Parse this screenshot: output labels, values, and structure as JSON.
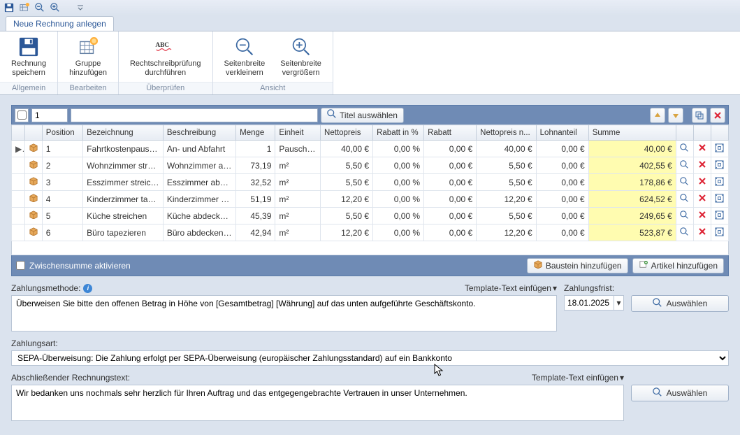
{
  "qat": {
    "icons": [
      "save",
      "new-table",
      "zoom-out",
      "zoom-in",
      "dropdown"
    ]
  },
  "ribbon_tab": "Neue Rechnung anlegen",
  "ribbon": {
    "groups": [
      {
        "title": "Allgemein",
        "buttons": [
          {
            "id": "save",
            "label": "Rechnung\nspeichern"
          }
        ]
      },
      {
        "title": "Bearbeiten",
        "buttons": [
          {
            "id": "addgroup",
            "label": "Gruppe\nhinzufügen"
          }
        ]
      },
      {
        "title": "Überprüfen",
        "buttons": [
          {
            "id": "spellcheck",
            "label": "Rechtschreibprüfung\ndurchführen"
          }
        ]
      },
      {
        "title": "Ansicht",
        "buttons": [
          {
            "id": "zoomout",
            "label": "Seitenbreite\nverkleinern"
          },
          {
            "id": "zoomin",
            "label": "Seitenbreite\nvergrößern"
          }
        ]
      }
    ]
  },
  "group": {
    "number": "1",
    "title_placeholder": "",
    "select_title_btn": "Titel auswählen"
  },
  "table": {
    "headers": [
      "",
      "",
      "Position",
      "Bezeichnung",
      "Beschreibung",
      "Menge",
      "Einheit",
      "Nettopreis",
      "Rabatt in %",
      "Rabatt",
      "Nettopreis n...",
      "Lohnanteil",
      "Summe",
      "",
      "",
      ""
    ],
    "rows": [
      {
        "mark": "▶",
        "pos": "1",
        "bez": "Fahrtkostenpausch...",
        "besch": "An- und Abfahrt",
        "menge": "1",
        "einheit": "Pauschale",
        "netto": "40,00 €",
        "rabp": "0,00 %",
        "rab": "0,00 €",
        "netton": "40,00 €",
        "lohn": "0,00 €",
        "sum": "40,00 €"
      },
      {
        "mark": "",
        "pos": "2",
        "bez": "Wohnzimmer streic...",
        "besch": "Wohnzimmer ab...",
        "menge": "73,19",
        "einheit": "m²",
        "netto": "5,50 €",
        "rabp": "0,00 %",
        "rab": "0,00 €",
        "netton": "5,50 €",
        "lohn": "0,00 €",
        "sum": "402,55 €"
      },
      {
        "mark": "",
        "pos": "3",
        "bez": "Esszimmer streichen",
        "besch": "Esszimmer abdeck...",
        "menge": "32,52",
        "einheit": "m²",
        "netto": "5,50 €",
        "rabp": "0,00 %",
        "rab": "0,00 €",
        "netton": "5,50 €",
        "lohn": "0,00 €",
        "sum": "178,86 €"
      },
      {
        "mark": "",
        "pos": "4",
        "bez": "Kinderzimmer tapez...",
        "besch": "Kinderzimmer ab...",
        "menge": "51,19",
        "einheit": "m²",
        "netto": "12,20 €",
        "rabp": "0,00 %",
        "rab": "0,00 €",
        "netton": "12,20 €",
        "lohn": "0,00 €",
        "sum": "624,52 €"
      },
      {
        "mark": "",
        "pos": "5",
        "bez": "Küche streichen",
        "besch": "Küche abdecken ...",
        "menge": "45,39",
        "einheit": "m²",
        "netto": "5,50 €",
        "rabp": "0,00 %",
        "rab": "0,00 €",
        "netton": "5,50 €",
        "lohn": "0,00 €",
        "sum": "249,65 €"
      },
      {
        "mark": "",
        "pos": "6",
        "bez": "Büro tapezieren",
        "besch": "Büro abdecken s...",
        "menge": "42,94",
        "einheit": "m²",
        "netto": "12,20 €",
        "rabp": "0,00 %",
        "rab": "0,00 €",
        "netton": "12,20 €",
        "lohn": "0,00 €",
        "sum": "523,87 €"
      }
    ]
  },
  "subtotal": {
    "checkbox_label": "Zwischensumme aktivieren",
    "btn_baustein": "Baustein hinzufügen",
    "btn_artikel": "Artikel hinzufügen"
  },
  "form": {
    "zahlungsmethode_label": "Zahlungsmethode:",
    "template_link": "Template-Text einfügen",
    "zahlungsmethode_text": "Überweisen Sie bitte den offenen Betrag in Höhe von [Gesamtbetrag] [Währung] auf das unten aufgeführte Geschäftskonto.",
    "zahlungsfrist_label": "Zahlungsfrist:",
    "zahlungsfrist_date": "18.01.2025",
    "auswaehlen_btn": "Auswählen",
    "zahlungsart_label": "Zahlungsart:",
    "zahlungsart_value": "SEPA-Überweisung: Die Zahlung erfolgt per SEPA-Überweisung (europäischer Zahlungsstandard) auf ein Bankkonto",
    "abschluss_label": "Abschließender Rechnungstext:",
    "abschluss_text": "Wir bedanken uns nochmals sehr herzlich für Ihren Auftrag und das entgegengebrachte Vertrauen in unser Unternehmen."
  }
}
